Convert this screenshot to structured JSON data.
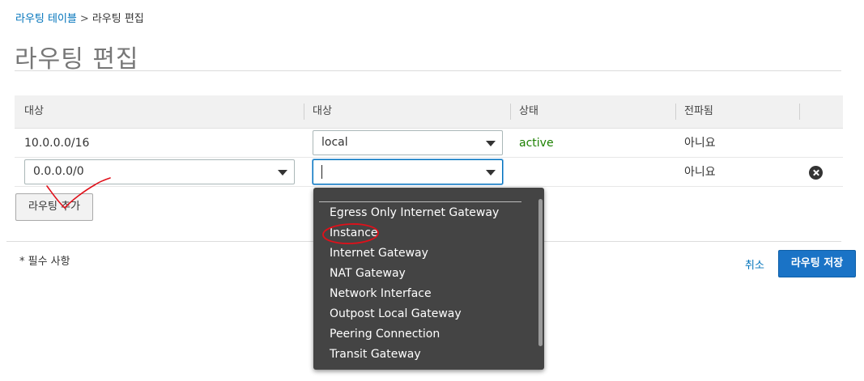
{
  "breadcrumb": {
    "parent": "라우팅 테이블",
    "separator": ">",
    "current": "라우팅 편집"
  },
  "page_title": "라우팅 편집",
  "table": {
    "headers": [
      "대상",
      "대상",
      "상태",
      "전파됨"
    ],
    "rows": [
      {
        "destination": "10.0.0.0/16",
        "target": "local",
        "status": "active",
        "propagated": "아니요"
      },
      {
        "destination": "0.0.0.0/0",
        "target": "",
        "status": "",
        "propagated": "아니요"
      }
    ]
  },
  "add_route_label": "라우팅 추가",
  "required_note": "* 필수 사항",
  "cancel_label": "취소",
  "save_label": "라우팅 저장",
  "dropdown": {
    "options": [
      "Egress Only Internet Gateway",
      "Instance",
      "Internet Gateway",
      "NAT Gateway",
      "Network Interface",
      "Outpost Local Gateway",
      "Peering Connection",
      "Transit Gateway"
    ]
  },
  "colors": {
    "link": "#0073bb",
    "active_status": "#1d8102",
    "primary_button": "#1a73c6",
    "dropdown_bg": "#444444",
    "annotation": "#e0101a"
  }
}
